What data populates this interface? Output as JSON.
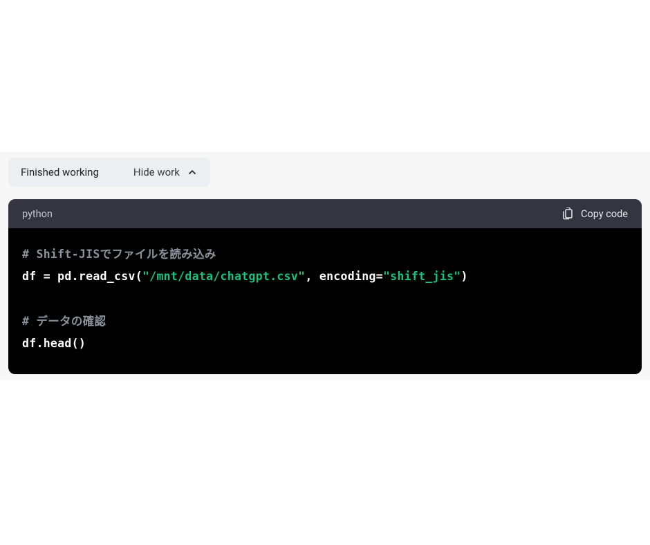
{
  "status": {
    "text": "Finished working",
    "toggle_label": "Hide work"
  },
  "code_block": {
    "language": "python",
    "copy_label": "Copy code",
    "lines": {
      "l1_comment_prefix": "# Shift-JIS",
      "l1_comment_rest": "でファイルを読み込み",
      "l2_a": "df = pd.read_csv(",
      "l2_str1": "\"/mnt/data/chatgpt.csv\"",
      "l2_b": ", encoding=",
      "l2_str2": "\"shift_jis\"",
      "l2_c": ")",
      "l4_comment": "# データの確認",
      "l5": "df.head()"
    }
  }
}
